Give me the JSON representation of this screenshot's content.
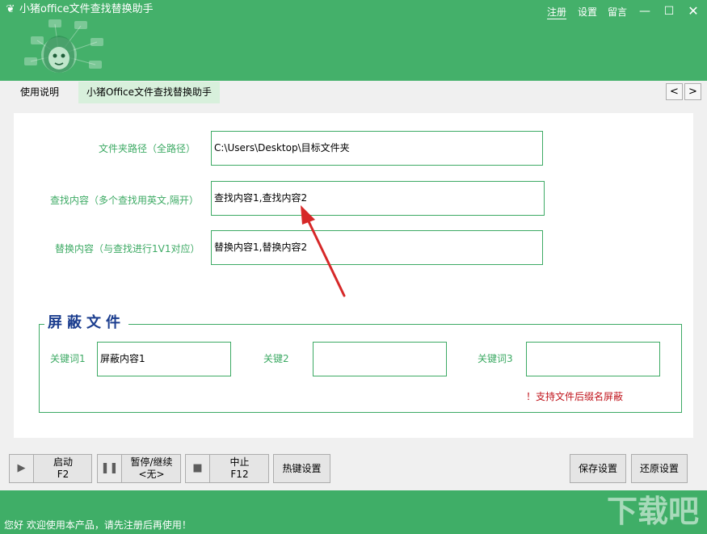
{
  "window": {
    "title": "小猪office文件查找替换助手",
    "links": {
      "register": "注册",
      "settings": "设置",
      "message": "留言"
    },
    "controls": {
      "minimize": "—",
      "maximize": "☐",
      "close": "✕"
    }
  },
  "tabs": [
    {
      "label": "使用说明"
    },
    {
      "label": "小猪Office文件查找替换助手"
    }
  ],
  "nav": {
    "prev": "<",
    "next": ">"
  },
  "form": {
    "path_label": "文件夹路径（全路径）",
    "path_value": "C:\\Users\\Desktop\\目标文件夹",
    "find_label": "查找内容（多个查找用英文,隔开）",
    "find_value": "查找内容1,查找内容2",
    "replace_label": "替换内容（与查找进行1V1对应）",
    "replace_value": "替换内容1,替换内容2"
  },
  "block_files": {
    "title": "屏蔽文件",
    "kw1_label": "关键词1",
    "kw1_value": "屏蔽内容1",
    "kw2_label": "关键2",
    "kw2_value": "",
    "kw3_label": "关键词3",
    "kw3_value": "",
    "note": "！支持文件后缀名屏蔽"
  },
  "toolbar": {
    "start_label": "启动",
    "start_key": "F2",
    "pause_label": "暂停/继续",
    "pause_key": "<无>",
    "stop_label": "中止",
    "stop_key": "F12",
    "hotkey_label": "热键设置",
    "save_label": "保存设置",
    "restore_label": "还原设置"
  },
  "status": {
    "text": "您好 欢迎使用本产品，请先注册后再使用！"
  },
  "icons": {
    "app": "pig-icon",
    "start": "play-icon",
    "pause": "pause-icon",
    "stop": "stop-icon"
  },
  "colors": {
    "brand_green": "#44b06a",
    "label_green": "#3daa64",
    "group_title_blue": "#1c3e8f",
    "warning_red": "#c0141c",
    "arrow_red": "#d62828"
  }
}
